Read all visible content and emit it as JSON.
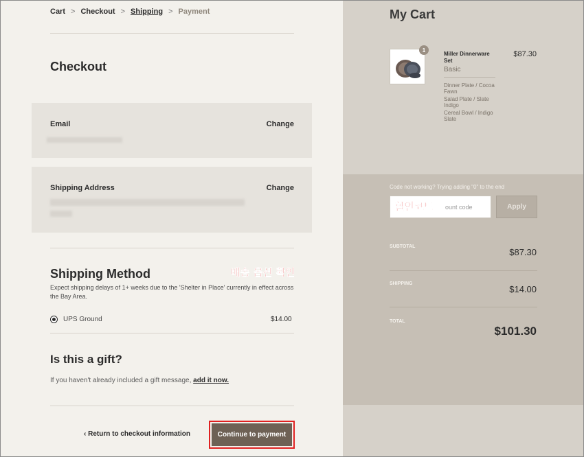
{
  "breadcrumb": {
    "items": [
      "Cart",
      "Checkout",
      "Shipping",
      "Payment"
    ],
    "separator": ">"
  },
  "checkout": {
    "title": "Checkout",
    "email": {
      "label": "Email",
      "change": "Change"
    },
    "address": {
      "label": "Shipping Address",
      "change": "Change"
    }
  },
  "shipping": {
    "title": "Shipping Method",
    "note": "Expect shipping delays of 1+ weeks due to the 'Shelter in Place' currently in effect across the Bay Area.",
    "option": "UPS Ground",
    "price": "$14.00"
  },
  "annotations": {
    "shipping": "배송 옵션 확인",
    "discount": "할인코드"
  },
  "gift": {
    "title": "Is this a gift?",
    "text": "If you haven't already included a gift message,",
    "link": "add it now."
  },
  "actions": {
    "return": "Return to checkout information",
    "return_icon": "chevron-left-icon",
    "continue": "Continue to payment"
  },
  "cart": {
    "title": "My Cart",
    "item": {
      "quantity": "1",
      "name": "Miller Dinnerware Set",
      "variant": "Basic",
      "price": "$87.30",
      "options": [
        "Dinner Plate / Cocoa Fawn",
        "Salad Plate / Slate Indigo",
        "Cereal Bowl / Indigo Slate"
      ]
    },
    "code_hint": "Code not working? Trying adding \"0\" to the end",
    "code_placeholder": "ount code",
    "apply": "Apply",
    "subtotal_label": "SUBTOTAL",
    "subtotal": "$87.30",
    "shipping_label": "SHIPPING",
    "shipping": "$14.00",
    "total_label": "TOTAL",
    "total": "$101.30"
  },
  "colors": {
    "left_bg": "#f3f1ec",
    "right_bg": "#d6d1c9",
    "button": "#6e6155",
    "annotation": "#e01515"
  }
}
